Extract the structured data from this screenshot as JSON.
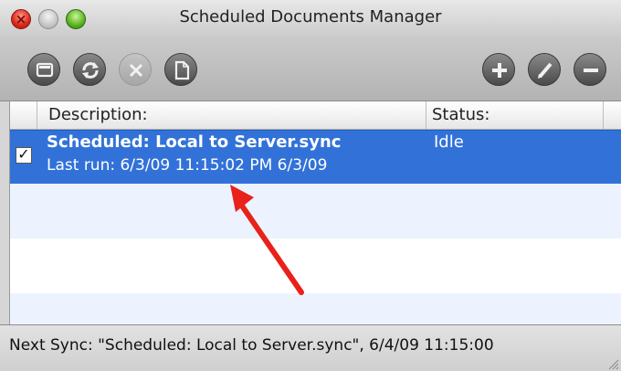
{
  "window": {
    "title": "Scheduled Documents Manager"
  },
  "toolbar": {
    "left_buttons": [
      {
        "icon": "terminal-icon",
        "enabled": true
      },
      {
        "icon": "refresh-icon",
        "enabled": true
      },
      {
        "icon": "stop-icon",
        "enabled": false
      },
      {
        "icon": "document-icon",
        "enabled": true
      }
    ],
    "right_buttons": [
      {
        "icon": "plus-icon",
        "enabled": true
      },
      {
        "icon": "pencil-icon",
        "enabled": true
      },
      {
        "icon": "minus-icon",
        "enabled": true
      }
    ]
  },
  "table": {
    "columns": [
      "Description:",
      "Status:"
    ],
    "rows": [
      {
        "checked": true,
        "title": "Scheduled: Local to Server.sync",
        "subtitle": "Last run: 6/3/09 11:15:02 PM  6/3/09",
        "status": "Idle",
        "selected": true
      }
    ]
  },
  "statusbar": {
    "text": "Next Sync: \"Scheduled: Local to Server.sync\", 6/4/09 11:15:00"
  },
  "colors": {
    "selection": "#3272d8",
    "annotation_arrow": "#e8211a"
  }
}
